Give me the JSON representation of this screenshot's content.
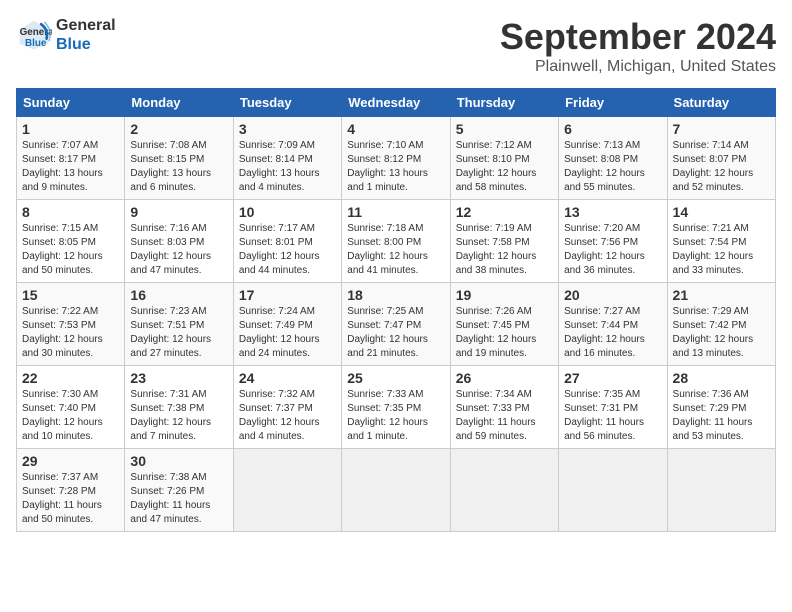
{
  "logo": {
    "line1": "General",
    "line2": "Blue"
  },
  "title": "September 2024",
  "subtitle": "Plainwell, Michigan, United States",
  "days_of_week": [
    "Sunday",
    "Monday",
    "Tuesday",
    "Wednesday",
    "Thursday",
    "Friday",
    "Saturday"
  ],
  "weeks": [
    [
      {
        "num": "1",
        "info": "Sunrise: 7:07 AM\nSunset: 8:17 PM\nDaylight: 13 hours\nand 9 minutes."
      },
      {
        "num": "2",
        "info": "Sunrise: 7:08 AM\nSunset: 8:15 PM\nDaylight: 13 hours\nand 6 minutes."
      },
      {
        "num": "3",
        "info": "Sunrise: 7:09 AM\nSunset: 8:14 PM\nDaylight: 13 hours\nand 4 minutes."
      },
      {
        "num": "4",
        "info": "Sunrise: 7:10 AM\nSunset: 8:12 PM\nDaylight: 13 hours\nand 1 minute."
      },
      {
        "num": "5",
        "info": "Sunrise: 7:12 AM\nSunset: 8:10 PM\nDaylight: 12 hours\nand 58 minutes."
      },
      {
        "num": "6",
        "info": "Sunrise: 7:13 AM\nSunset: 8:08 PM\nDaylight: 12 hours\nand 55 minutes."
      },
      {
        "num": "7",
        "info": "Sunrise: 7:14 AM\nSunset: 8:07 PM\nDaylight: 12 hours\nand 52 minutes."
      }
    ],
    [
      {
        "num": "8",
        "info": "Sunrise: 7:15 AM\nSunset: 8:05 PM\nDaylight: 12 hours\nand 50 minutes."
      },
      {
        "num": "9",
        "info": "Sunrise: 7:16 AM\nSunset: 8:03 PM\nDaylight: 12 hours\nand 47 minutes."
      },
      {
        "num": "10",
        "info": "Sunrise: 7:17 AM\nSunset: 8:01 PM\nDaylight: 12 hours\nand 44 minutes."
      },
      {
        "num": "11",
        "info": "Sunrise: 7:18 AM\nSunset: 8:00 PM\nDaylight: 12 hours\nand 41 minutes."
      },
      {
        "num": "12",
        "info": "Sunrise: 7:19 AM\nSunset: 7:58 PM\nDaylight: 12 hours\nand 38 minutes."
      },
      {
        "num": "13",
        "info": "Sunrise: 7:20 AM\nSunset: 7:56 PM\nDaylight: 12 hours\nand 36 minutes."
      },
      {
        "num": "14",
        "info": "Sunrise: 7:21 AM\nSunset: 7:54 PM\nDaylight: 12 hours\nand 33 minutes."
      }
    ],
    [
      {
        "num": "15",
        "info": "Sunrise: 7:22 AM\nSunset: 7:53 PM\nDaylight: 12 hours\nand 30 minutes."
      },
      {
        "num": "16",
        "info": "Sunrise: 7:23 AM\nSunset: 7:51 PM\nDaylight: 12 hours\nand 27 minutes."
      },
      {
        "num": "17",
        "info": "Sunrise: 7:24 AM\nSunset: 7:49 PM\nDaylight: 12 hours\nand 24 minutes."
      },
      {
        "num": "18",
        "info": "Sunrise: 7:25 AM\nSunset: 7:47 PM\nDaylight: 12 hours\nand 21 minutes."
      },
      {
        "num": "19",
        "info": "Sunrise: 7:26 AM\nSunset: 7:45 PM\nDaylight: 12 hours\nand 19 minutes."
      },
      {
        "num": "20",
        "info": "Sunrise: 7:27 AM\nSunset: 7:44 PM\nDaylight: 12 hours\nand 16 minutes."
      },
      {
        "num": "21",
        "info": "Sunrise: 7:29 AM\nSunset: 7:42 PM\nDaylight: 12 hours\nand 13 minutes."
      }
    ],
    [
      {
        "num": "22",
        "info": "Sunrise: 7:30 AM\nSunset: 7:40 PM\nDaylight: 12 hours\nand 10 minutes."
      },
      {
        "num": "23",
        "info": "Sunrise: 7:31 AM\nSunset: 7:38 PM\nDaylight: 12 hours\nand 7 minutes."
      },
      {
        "num": "24",
        "info": "Sunrise: 7:32 AM\nSunset: 7:37 PM\nDaylight: 12 hours\nand 4 minutes."
      },
      {
        "num": "25",
        "info": "Sunrise: 7:33 AM\nSunset: 7:35 PM\nDaylight: 12 hours\nand 1 minute."
      },
      {
        "num": "26",
        "info": "Sunrise: 7:34 AM\nSunset: 7:33 PM\nDaylight: 11 hours\nand 59 minutes."
      },
      {
        "num": "27",
        "info": "Sunrise: 7:35 AM\nSunset: 7:31 PM\nDaylight: 11 hours\nand 56 minutes."
      },
      {
        "num": "28",
        "info": "Sunrise: 7:36 AM\nSunset: 7:29 PM\nDaylight: 11 hours\nand 53 minutes."
      }
    ],
    [
      {
        "num": "29",
        "info": "Sunrise: 7:37 AM\nSunset: 7:28 PM\nDaylight: 11 hours\nand 50 minutes."
      },
      {
        "num": "30",
        "info": "Sunrise: 7:38 AM\nSunset: 7:26 PM\nDaylight: 11 hours\nand 47 minutes."
      },
      {
        "num": "",
        "info": ""
      },
      {
        "num": "",
        "info": ""
      },
      {
        "num": "",
        "info": ""
      },
      {
        "num": "",
        "info": ""
      },
      {
        "num": "",
        "info": ""
      }
    ]
  ]
}
